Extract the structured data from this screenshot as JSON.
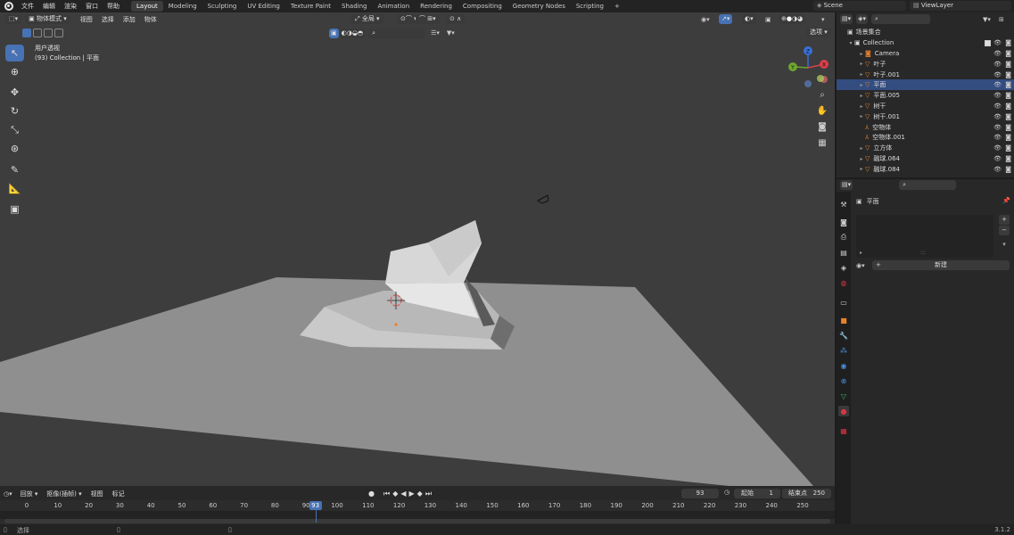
{
  "topbar": {
    "menus": [
      "文件",
      "编辑",
      "渲染",
      "窗口",
      "帮助"
    ],
    "workspaces": [
      "Layout",
      "Modeling",
      "Sculpting",
      "UV Editing",
      "Texture Paint",
      "Shading",
      "Animation",
      "Rendering",
      "Compositing",
      "Geometry Nodes",
      "Scripting"
    ],
    "active_workspace": "Layout",
    "add_tab": "+",
    "scene": "Scene",
    "view_layer": "ViewLayer"
  },
  "viewport": {
    "mode": "物体模式",
    "menus": [
      "视图",
      "选择",
      "添加",
      "物体"
    ],
    "orientation": "全局",
    "options_label": "选项",
    "view_name": "用户透视",
    "view_collection": "(93) Collection | 平面",
    "gizmo": {
      "x": "X",
      "y": "Y",
      "z": "Z"
    }
  },
  "outliner": {
    "root": "场景集合",
    "collection": "Collection",
    "items": [
      {
        "name": "Camera",
        "icon": "camera-icon"
      },
      {
        "name": "叶子",
        "icon": "mesh-icon"
      },
      {
        "name": "叶子.001",
        "icon": "mesh-icon"
      },
      {
        "name": "平面",
        "icon": "mesh-icon"
      },
      {
        "name": "平面.005",
        "icon": "mesh-icon"
      },
      {
        "name": "树干",
        "icon": "mesh-icon"
      },
      {
        "name": "树干.001",
        "icon": "mesh-icon"
      },
      {
        "name": "空物体",
        "icon": "empty-icon"
      },
      {
        "name": "空物体.001",
        "icon": "empty-icon"
      },
      {
        "name": "立方体",
        "icon": "mesh-icon"
      },
      {
        "name": "融球.064",
        "icon": "mesh-icon"
      },
      {
        "name": "融球.084",
        "icon": "mesh-icon"
      }
    ],
    "selected_index": 3
  },
  "properties": {
    "object_name": "平面",
    "new_button": "新建",
    "dots": ":::"
  },
  "timeline": {
    "menus": [
      "回放",
      "抠像(插帧)",
      "视图",
      "标记"
    ],
    "current_frame": "93",
    "start_label": "起始",
    "start_value": "1",
    "end_label": "结束点",
    "end_value": "250",
    "ticks": [
      "0",
      "10",
      "20",
      "30",
      "40",
      "50",
      "60",
      "70",
      "80",
      "90",
      "100",
      "110",
      "120",
      "130",
      "140",
      "150",
      "160",
      "170",
      "180",
      "190",
      "200",
      "210",
      "220",
      "230",
      "240",
      "250"
    ]
  },
  "statusbar": {
    "select_label": "选择",
    "version": "3.1.2"
  },
  "colors": {
    "accent": "#4772b3",
    "viewport_bg": "#3d3d3d",
    "panel_bg": "#282828",
    "mesh_orange": "#e8822a",
    "mesh_green": "#2fbf71"
  }
}
